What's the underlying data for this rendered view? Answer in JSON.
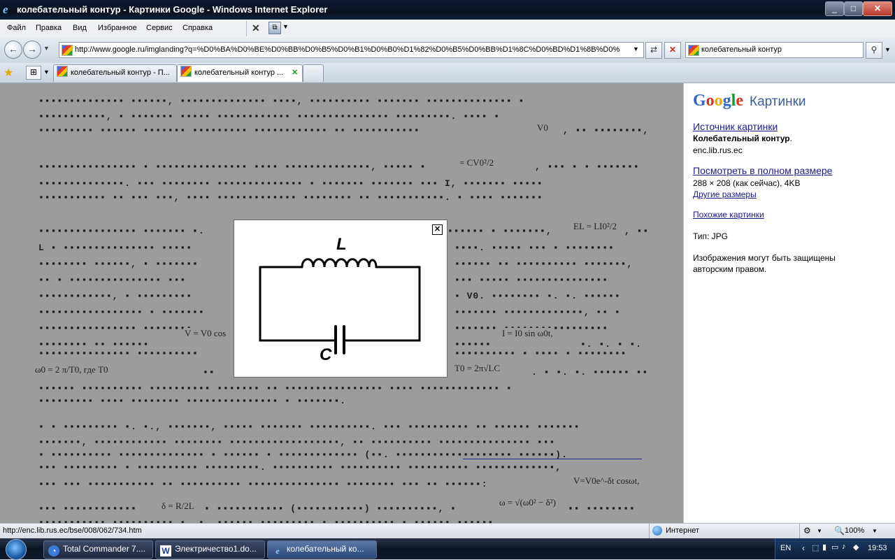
{
  "window": {
    "title": "колебательный контур - Картинки Google - Windows Internet Explorer",
    "buttons": {
      "minimize": "_",
      "maximize": "□",
      "close": "✕"
    }
  },
  "menu": [
    "Файл",
    "Правка",
    "Вид",
    "Избранное",
    "Сервис",
    "Справка"
  ],
  "address": {
    "url": "http://www.google.ru/imglanding?q=%D0%BA%D0%BE%D0%BB%D0%B5%D0%B1%D0%B0%D1%82%D0%B5%D0%BB%D1%8C%D0%BD%D1%8B%D0%B9"
  },
  "search": {
    "value": "колебательный контур"
  },
  "tabs": [
    {
      "label": "колебательный контур - П..."
    },
    {
      "label": "колебательный контур ..."
    }
  ],
  "document": {
    "formula_w0": "= CV0²/2",
    "formula_el": "EL = LI0²/2",
    "formula_v": "V0",
    "formula_vcos": "V = V0 cos",
    "formula_isin": "I = I0 sin ω0t, ",
    "formula_w2pi": "ω0 = 2 π/T0, где T0",
    "formula_T0": "T0 = 2π√LC",
    "formula_decay": "V=V0e^-δt cosωt,",
    "formula_delta": "δ = R/2L",
    "formula_omega": "ω = √(ω0² − δ²)"
  },
  "popup": {
    "close_label": "✕",
    "inductor_label": "L",
    "capacitor_label": "C"
  },
  "sidebar": {
    "logo_google": "Google",
    "logo_images": "Картинки",
    "source_label": "Источник картинки",
    "source_title": "Колебательный контур",
    "source_title_suffix": ".",
    "source_domain": "enc.lib.rus.ec",
    "fullsize_label": "Посмотреть в полном размере",
    "size_info": "288 × 208 (как сейчас), 4KB",
    "other_sizes": "Другие размеры",
    "similar": "Похожие картинки",
    "type_label": "Тип:  JPG",
    "copyright": "Изображения могут быть защищены",
    "copyright2": "авторским правом."
  },
  "status": {
    "url": "http://enc.lib.rus.ec/bse/008/062/734.htm",
    "zone": "Интернет",
    "zoom": "100%"
  },
  "taskbar": {
    "items": [
      {
        "label": "Total Commander 7...."
      },
      {
        "label": "Электричество1.do..."
      },
      {
        "label": "колебательный ко..."
      }
    ],
    "lang": "EN",
    "clock": "19:53"
  },
  "colors": {
    "content_bg": "#9c9c9c",
    "google_blue": "#3366cc",
    "google_red": "#dd3322",
    "google_yellow": "#eeaa00",
    "google_green": "#119933"
  }
}
